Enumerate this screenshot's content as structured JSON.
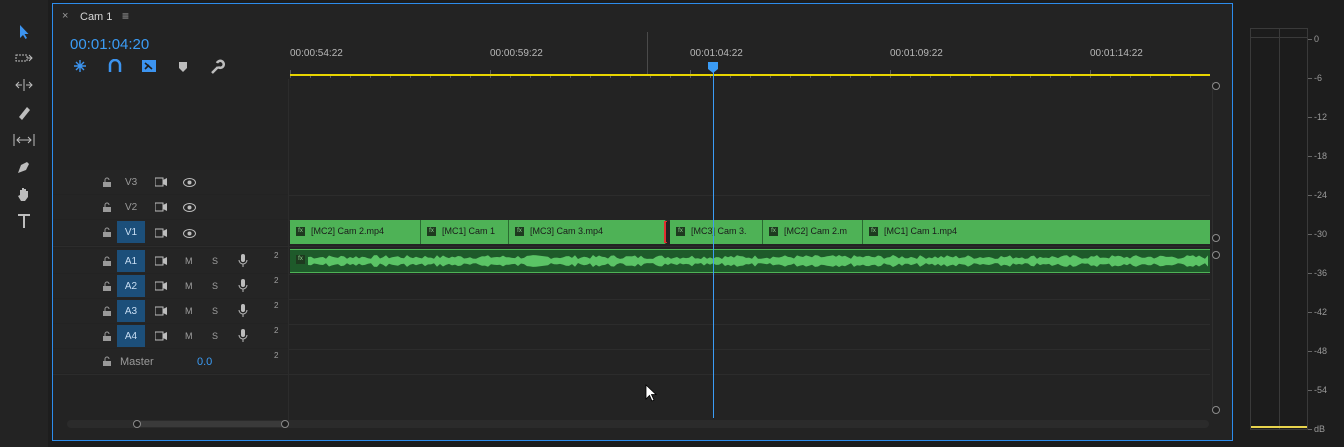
{
  "tab": {
    "close": "×",
    "title": "Cam 1",
    "menu": "≡"
  },
  "timecode": "00:01:04:20",
  "ruler": [
    "00:00:54:22",
    "00:00:59:22",
    "00:01:04:22",
    "00:01:09:22",
    "00:01:14:22"
  ],
  "tracks": {
    "video": [
      {
        "name": "V3",
        "targeted": false
      },
      {
        "name": "V2",
        "targeted": false
      },
      {
        "name": "V1",
        "targeted": true
      }
    ],
    "audio": [
      {
        "name": "A1",
        "m": "M",
        "s": "S",
        "ch": "2"
      },
      {
        "name": "A2",
        "m": "M",
        "s": "S",
        "ch": "2"
      },
      {
        "name": "A3",
        "m": "M",
        "s": "S",
        "ch": "2"
      },
      {
        "name": "A4",
        "m": "M",
        "s": "S",
        "ch": "2"
      }
    ],
    "master": {
      "label": "Master",
      "value": "0.0",
      "ch": "2"
    }
  },
  "clips": [
    {
      "label": "[MC2] Cam 2.mp4",
      "fx": "fx"
    },
    {
      "label": "[MC1] Cam 1",
      "fx": "fx"
    },
    {
      "label": "[MC3] Cam 3.mp4",
      "fx": "fx"
    },
    {
      "label": "[MC3] Cam 3.",
      "fx": "fx"
    },
    {
      "label": "[MC2] Cam 2.m",
      "fx": "fx"
    },
    {
      "label": "[MC1] Cam 1.mp4",
      "fx": "fx"
    }
  ],
  "audio_clip_fx": "fx",
  "meter": {
    "scale": [
      "0",
      "-6",
      "-12",
      "-18",
      "-24",
      "-30",
      "-36",
      "-42",
      "-48",
      "-54",
      "dB"
    ],
    "accent": "#e8d44d"
  },
  "colors": {
    "accent": "#2d8ceb",
    "clip": "#4eb256",
    "workarea": "#e8d400",
    "playhead": "#3b9cf5"
  },
  "tools": [
    "selection-tool",
    "track-select-tool",
    "ripple-edit-tool",
    "razor-tool",
    "slip-tool",
    "pen-tool",
    "hand-tool",
    "type-tool"
  ]
}
